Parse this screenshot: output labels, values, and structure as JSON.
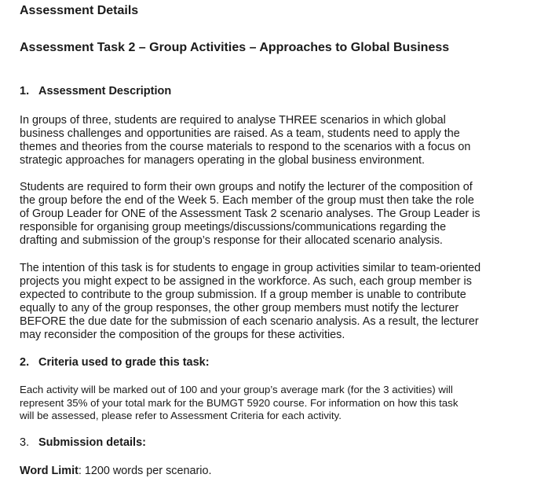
{
  "heading": "Assessment Details",
  "task_title": "Assessment Task 2 – Group Activities – Approaches to Global Business",
  "sections": [
    {
      "number": "1.",
      "title": "Assessment Description"
    },
    {
      "number": "2.",
      "title": "Criteria used to grade this task:"
    },
    {
      "number": "3.",
      "title": "Submission details:"
    }
  ],
  "paragraphs": [
    {
      "lines": [
        "In groups of three, students are required to analyse THREE scenarios in which global",
        "business challenges and opportunities are raised. As a team, students need to apply the",
        "themes and theories from the course materials to respond to the scenarios with a focus on",
        "strategic approaches for managers operating in the global business environment."
      ]
    },
    {
      "lines": [
        "Students are required to form their own groups and notify the lecturer of the composition of",
        "the group before the end of the Week 5. Each member of the group must then take the role",
        "of Group Leader for ONE of the Assessment Task 2 scenario analyses. The Group Leader is",
        "responsible for organising group meetings/discussions/communications regarding the",
        "drafting and submission of the group’s response for their allocated scenario analysis."
      ]
    },
    {
      "lines": [
        "The intention of this task is for students to engage in group activities similar to team-oriented",
        "projects you might expect to be assigned in the workforce. As such, each group member is",
        "expected to contribute to the group submission. If a group member is unable to contribute",
        "equally to any of the group responses, the other group members must notify the lecturer",
        "BEFORE the due date for the submission of each scenario analysis. As a result, the lecturer",
        "may reconsider the composition of the groups for these activities."
      ]
    },
    {
      "lines": [
        "Each activity will be marked out of 100 and your group’s average mark (for the 3 activities) will",
        "represent 35% of your total mark for the BUMGT 5920 course. For information on how this task",
        "will be assessed, please refer to Assessment Criteria for each activity."
      ]
    }
  ],
  "word_limit": {
    "label": "Word Limit",
    "value": ": 1200 words per scenario."
  }
}
